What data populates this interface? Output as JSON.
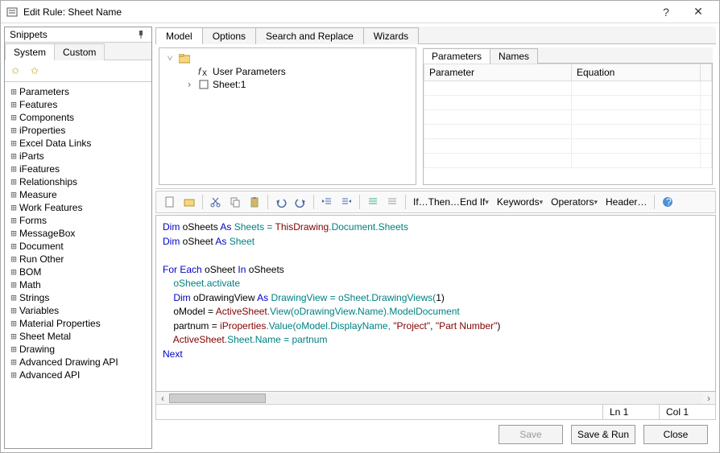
{
  "window": {
    "title": "Edit Rule: Sheet Name"
  },
  "snippets": {
    "title": "Snippets",
    "tabs": {
      "system": "System",
      "custom": "Custom"
    },
    "items": [
      "Parameters",
      "Features",
      "Components",
      "iProperties",
      "Excel Data Links",
      "iParts",
      "iFeatures",
      "Relationships",
      "Measure",
      "Work Features",
      "Forms",
      "MessageBox",
      "Document",
      "Run Other",
      "BOM",
      "Math",
      "Strings",
      "Variables",
      "Material Properties",
      "Sheet Metal",
      "Drawing",
      "Advanced Drawing API",
      "Advanced API"
    ]
  },
  "main_tabs": {
    "model": "Model",
    "options": "Options",
    "search": "Search and Replace",
    "wizards": "Wizards"
  },
  "model_tree": {
    "user_params": "User Parameters",
    "sheet1": "Sheet:1"
  },
  "param_tabs": {
    "parameters": "Parameters",
    "names": "Names"
  },
  "param_headers": {
    "parameter": "Parameter",
    "equation": "Equation"
  },
  "toolbar": {
    "ifthen": "If…Then…End If",
    "keywords": "Keywords",
    "operators": "Operators",
    "header": "Header…"
  },
  "code": {
    "l1a": "Dim",
    "l1b": " oSheets ",
    "l1c": "As",
    "l1d": " Sheets = ",
    "l1e": "ThisDrawing",
    "l1f": ".Document.Sheets",
    "l2a": "Dim",
    "l2b": " oSheet ",
    "l2c": "As",
    "l2d": " Sheet",
    "l4a": "For Each",
    "l4b": " oSheet ",
    "l4c": "In",
    "l4d": " oSheets",
    "l5": "    oSheet.activate",
    "l6a": "    ",
    "l6b": "Dim",
    "l6c": " oDrawingView ",
    "l6d": "As",
    "l6e": " DrawingView = oSheet.DrawingViews(",
    "l6f": "1",
    "l6g": ")",
    "l7a": "    oModel = ",
    "l7b": "ActiveSheet",
    "l7c": ".View(oDrawingView.Name).ModelDocument",
    "l8a": "    partnum = ",
    "l8b": "iProperties",
    "l8c": ".Value(oModel.DisplayName, ",
    "l8d": "\"Project\"",
    "l8e": ", ",
    "l8f": "\"Part Number\"",
    "l8g": ")",
    "l9a": "    ",
    "l9b": "ActiveSheet",
    "l9c": ".Sheet.Name = partnum",
    "l10": "Next"
  },
  "status": {
    "ln": "Ln 1",
    "col": "Col 1"
  },
  "buttons": {
    "save": "Save",
    "saverun": "Save & Run",
    "close": "Close"
  }
}
